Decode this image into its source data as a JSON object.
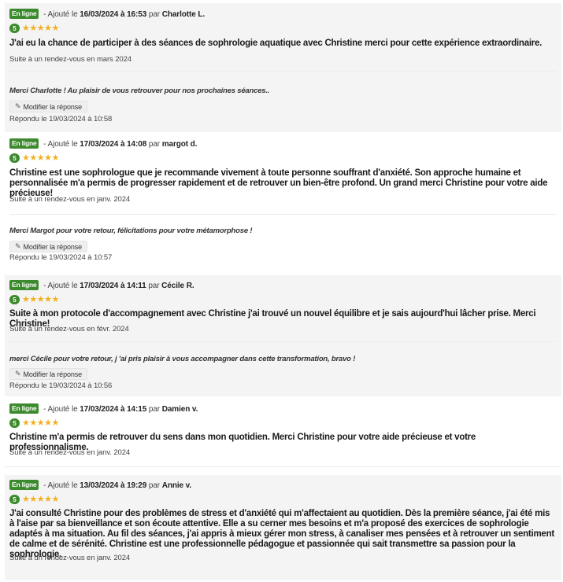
{
  "reviews": [
    {
      "status": "En ligne",
      "added_prefix": "- Ajouté le",
      "date": "16/03/2024 à 16:53",
      "by": "par",
      "author": "Charlotte L.",
      "score": "5",
      "stars": "★★★★★",
      "text": "J'ai eu la chance de participer à des séances de sophrologie aquatique avec Christine merci pour cette expérience extraordinaire.",
      "visit": "Suite à un rendez-vous en mars 2024",
      "reply": {
        "text": "Merci Charlotte ! Au plaisir de vous retrouver pour nos prochaines séances..",
        "edit_label": "Modifier la réponse",
        "replied": "Répondu le 19/03/2024 à 10:58"
      }
    },
    {
      "status": "En ligne",
      "added_prefix": "- Ajouté le",
      "date": "17/03/2024 à 14:08",
      "by": "par",
      "author": "margot d.",
      "score": "5",
      "stars": "★★★★★",
      "text": "Christine est une sophrologue que je recommande vivement à toute personne souffrant d'anxiété. Son approche humaine et personnalisée m'a permis de progresser rapidement et de retrouver un bien-être profond. Un grand merci Christine pour votre aide précieuse!",
      "visit": "Suite à un rendez-vous en janv. 2024",
      "reply": {
        "text": "Merci Margot pour votre retour, félicitations pour votre métamorphose !",
        "edit_label": "Modifier la réponse",
        "replied": "Répondu le 19/03/2024 à 10:57"
      }
    },
    {
      "status": "En ligne",
      "added_prefix": "- Ajouté le",
      "date": "17/03/2024 à 14:11",
      "by": "par",
      "author": "Cécile R.",
      "score": "5",
      "stars": "★★★★★",
      "text": "Suite à mon protocole d'accompagnement avec Christine j'ai trouvé un nouvel équilibre et je sais aujourd'hui lâcher prise. Merci Christine!",
      "visit": "Suite à un rendez-vous en févr. 2024",
      "reply": {
        "text": "merci Cécile pour votre retour, j 'ai pris plaisir à vous accompagner dans cette transformation, bravo !",
        "edit_label": "Modifier la réponse",
        "replied": "Répondu le 19/03/2024 à 10:56"
      }
    },
    {
      "status": "En ligne",
      "added_prefix": "- Ajouté le",
      "date": "17/03/2024 à 14:15",
      "by": "par",
      "author": "Damien v.",
      "score": "5",
      "stars": "★★★★★",
      "text": "Christine m'a permis de retrouver du sens dans mon quotidien. Merci Christine pour votre aide précieuse et votre professionnalisme.",
      "visit": "Suite à un rendez-vous en janv. 2024"
    },
    {
      "status": "En ligne",
      "added_prefix": "- Ajouté le",
      "date": "13/03/2024 à 19:29",
      "by": "par",
      "author": "Annie v.",
      "score": "5",
      "stars": "★★★★★",
      "text": "J'ai consulté Christine pour des problèmes de stress et d'anxiété qui m'affectaient au quotidien. Dès la première séance, j'ai été mis à l'aise par sa bienveillance et son écoute attentive. Elle a su cerner mes besoins et m'a proposé des exercices de sophrologie adaptés à ma situation. Au fil des séances, j'ai appris à mieux gérer mon stress, à canaliser mes pensées et à retrouver un sentiment de calme et de sérénité. Christine est une professionnelle pédagogue et passionnée qui sait transmettre sa passion pour la sophrologie.",
      "visit": "Suite à un rendez-vous en janv. 2024"
    }
  ]
}
